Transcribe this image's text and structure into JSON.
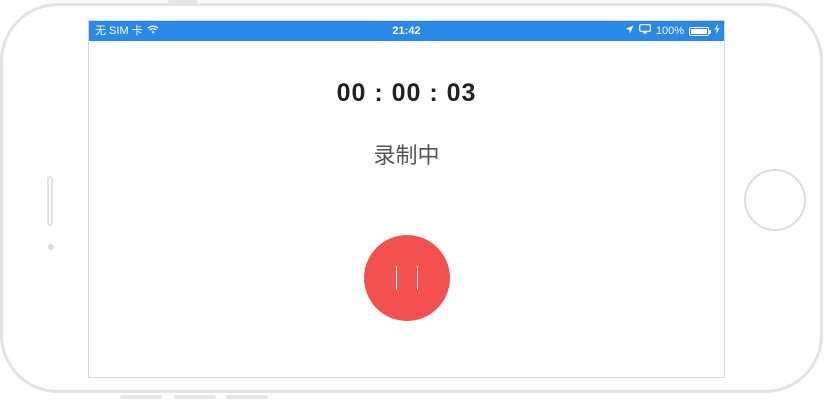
{
  "status_bar": {
    "carrier": "无 SIM 卡",
    "time": "21:42",
    "battery_percent": "100%",
    "battery_level": 1.0,
    "icons": [
      "wifi-icon",
      "location-arrow-icon",
      "airplay-icon",
      "battery-icon",
      "charging-bolt-icon"
    ],
    "background_color": "#2a89e8"
  },
  "recorder": {
    "elapsed": "00 : 00 : 03",
    "state_label": "录制中",
    "pause_button_color": "#f55050",
    "pause_icon": "pause-icon"
  }
}
